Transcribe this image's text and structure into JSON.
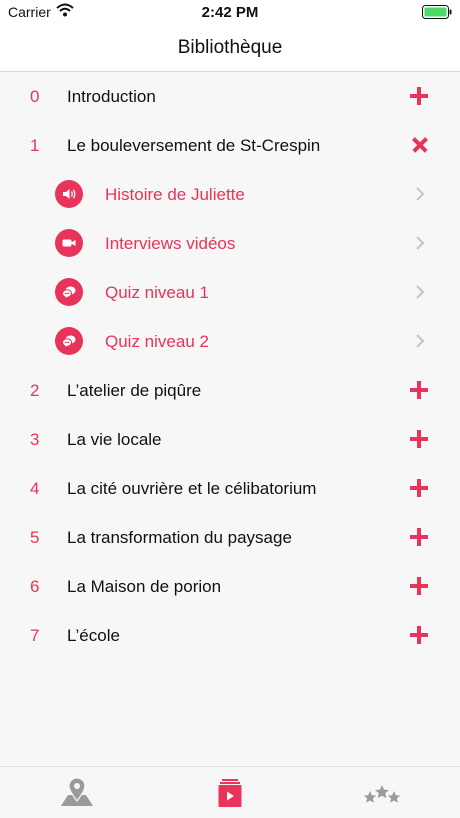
{
  "status_bar": {
    "carrier": "Carrier",
    "time": "2:42 PM"
  },
  "nav": {
    "title": "Bibliothèque"
  },
  "chapters": [
    {
      "num": "0",
      "title": "Introduction"
    },
    {
      "num": "1",
      "title": "Le bouleversement de St-Crespin"
    },
    {
      "num": "2",
      "title": "L’atelier de piqûre"
    },
    {
      "num": "3",
      "title": "La vie locale"
    },
    {
      "num": "4",
      "title": "La cité ouvrière et le célibatorium"
    },
    {
      "num": "5",
      "title": "La transformation du paysage"
    },
    {
      "num": "6",
      "title": "La Maison de porion"
    },
    {
      "num": "7",
      "title": "L’école"
    }
  ],
  "sub_items": [
    {
      "title": "Histoire de Juliette",
      "icon": "speaker-icon"
    },
    {
      "title": "Interviews vidéos",
      "icon": "video-camera-icon"
    },
    {
      "title": "Quiz niveau 1",
      "icon": "quiz-icon"
    },
    {
      "title": "Quiz niveau 2",
      "icon": "quiz-icon"
    }
  ],
  "tabs": [
    {
      "name": "map",
      "icon": "map-pin-icon",
      "active": false
    },
    {
      "name": "library",
      "icon": "library-icon",
      "active": true
    },
    {
      "name": "score",
      "icon": "stars-icon",
      "active": false
    }
  ],
  "colors": {
    "accent": "#e8345a",
    "inactive_icon": "#9a9a9a",
    "battery": "#4cd964"
  }
}
